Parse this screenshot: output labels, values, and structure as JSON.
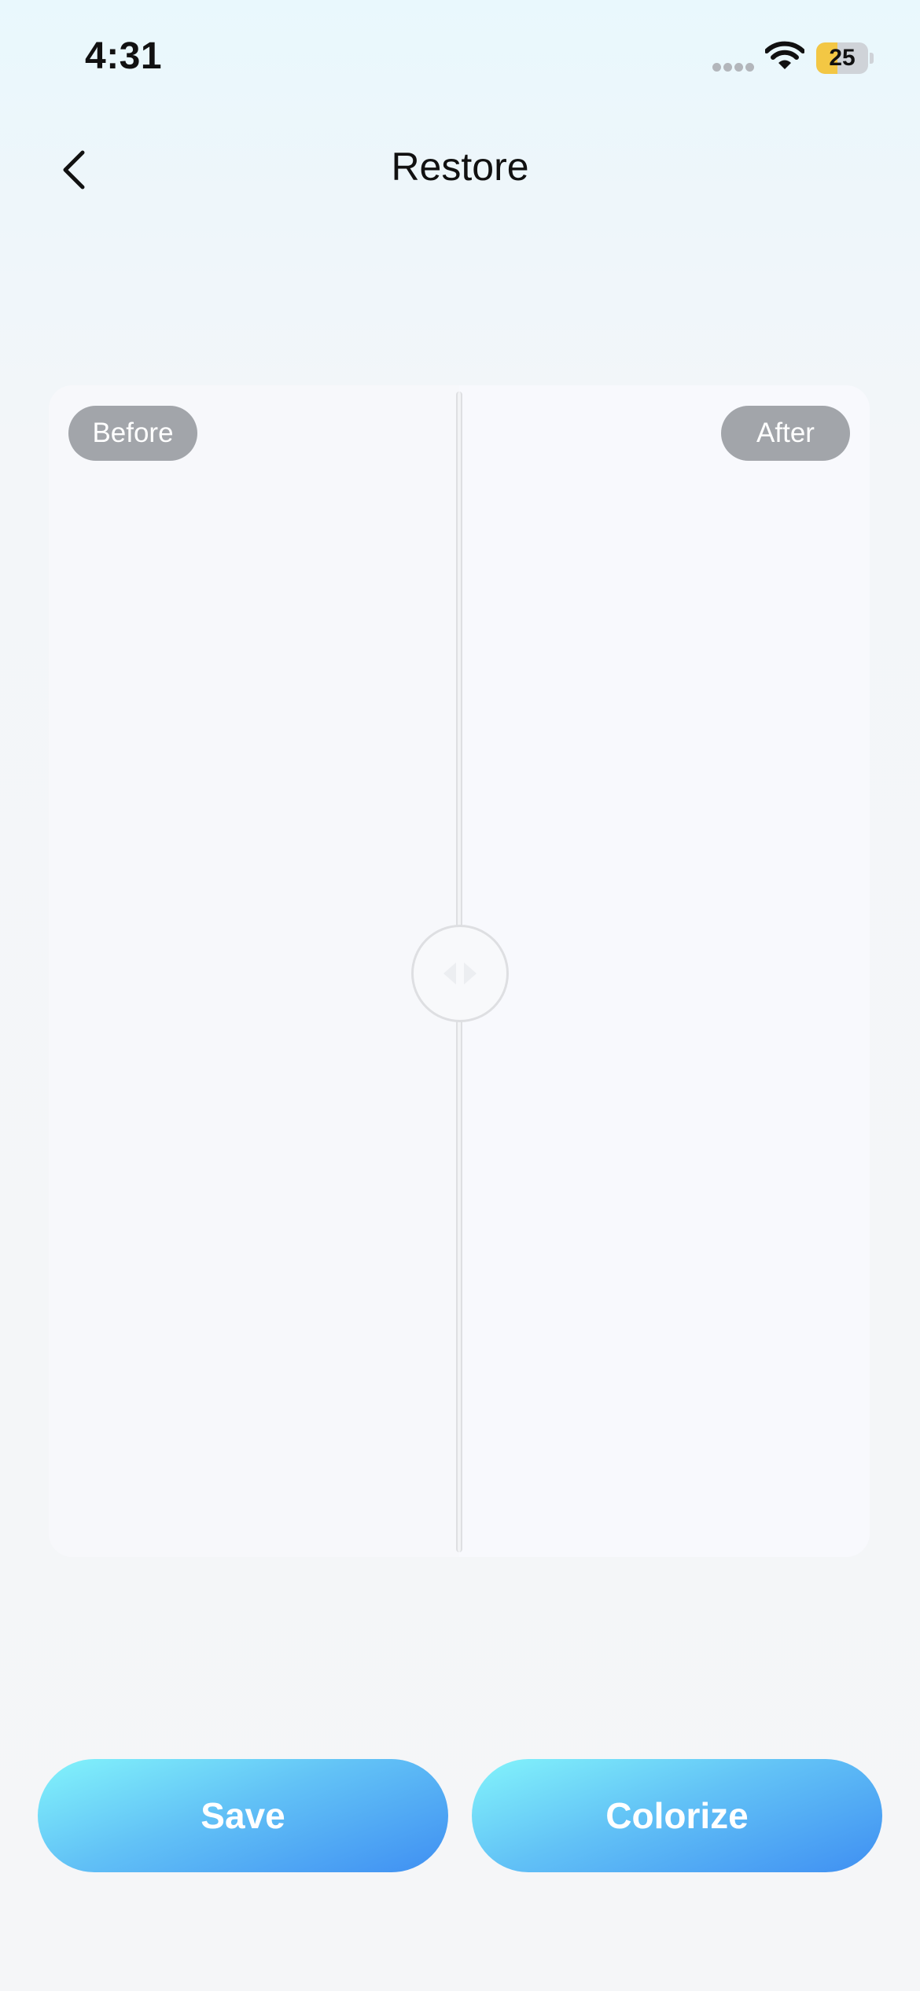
{
  "status_bar": {
    "time": "4:31",
    "battery_level": "25",
    "battery_fraction": 0.25,
    "battery_color": "#f3c744"
  },
  "nav": {
    "title": "Restore",
    "back_icon": "chevron-left-icon"
  },
  "compare": {
    "before_label": "Before",
    "after_label": "After",
    "handle_icon": "left-right-arrows-icon"
  },
  "actions": {
    "save_label": "Save",
    "colorize_label": "Colorize"
  },
  "colors": {
    "button_gradient_start": "#83f4fb",
    "button_gradient_end": "#3f8ff2",
    "pill_background": "#a2a5aa"
  }
}
